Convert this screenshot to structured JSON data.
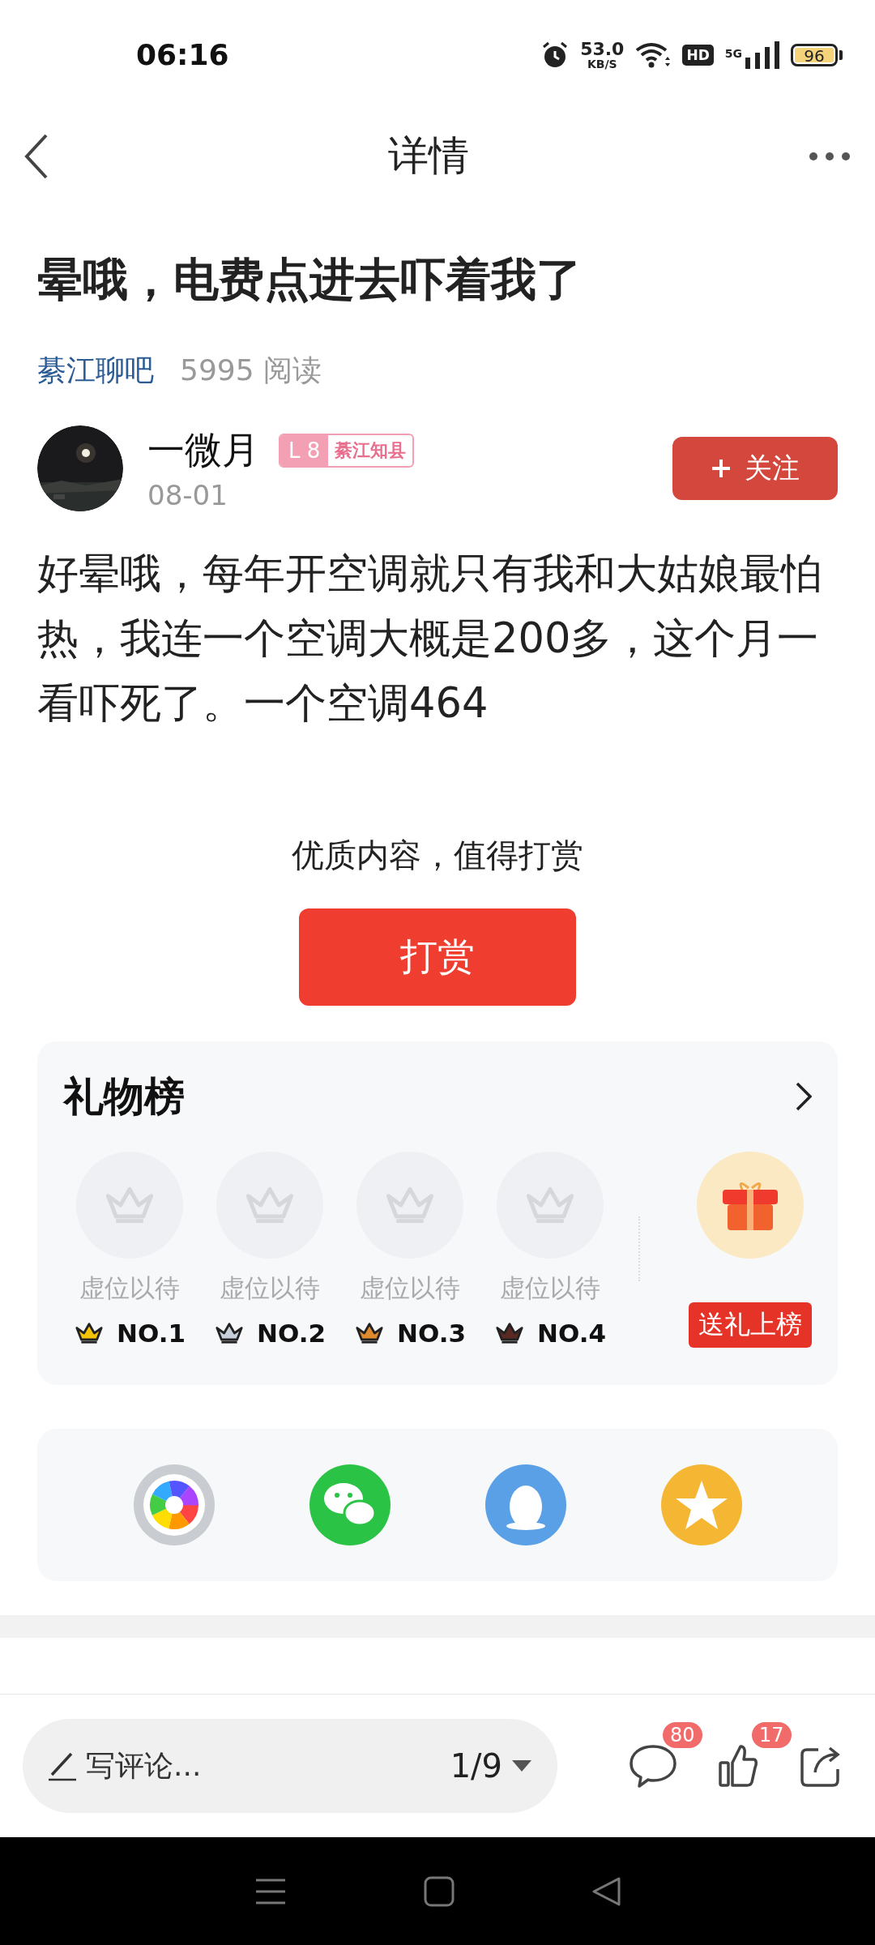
{
  "status_bar": {
    "time": "06:16",
    "speed_value": "53.0",
    "speed_unit": "KB/S",
    "hd": "HD",
    "network": "5G",
    "battery": "96"
  },
  "nav": {
    "title": "详情"
  },
  "post": {
    "title": "晕哦，电费点进去吓着我了",
    "forum": "綦江聊吧",
    "reads": "5995 阅读",
    "author": "一微月",
    "level": "L 8",
    "rank_title": "綦江知县",
    "date": "08-01",
    "follow": "关注",
    "body": "好晕哦，每年开空调就只有我和大姑娘最怕热，我连一个空调大概是200多，这个月一看吓死了。一个空调464"
  },
  "reward": {
    "prompt": "优质内容，值得打赏",
    "button": "打赏"
  },
  "gift_board": {
    "title": "礼物榜",
    "slots": [
      {
        "label": "虚位以待",
        "rank": "NO.1",
        "color": "#f5c400"
      },
      {
        "label": "虚位以待",
        "rank": "NO.2",
        "color": "#c5d0da"
      },
      {
        "label": "虚位以待",
        "rank": "NO.3",
        "color": "#e08a2e"
      },
      {
        "label": "虚位以待",
        "rank": "NO.4",
        "color": "#5a2a22"
      }
    ],
    "send": "送礼上榜"
  },
  "share": [
    {
      "kind": "moments"
    },
    {
      "kind": "wechat"
    },
    {
      "kind": "qq"
    },
    {
      "kind": "qzone"
    }
  ],
  "bottom_bar": {
    "placeholder": "写评论...",
    "page": "1/9",
    "comments": "80",
    "likes": "17"
  }
}
